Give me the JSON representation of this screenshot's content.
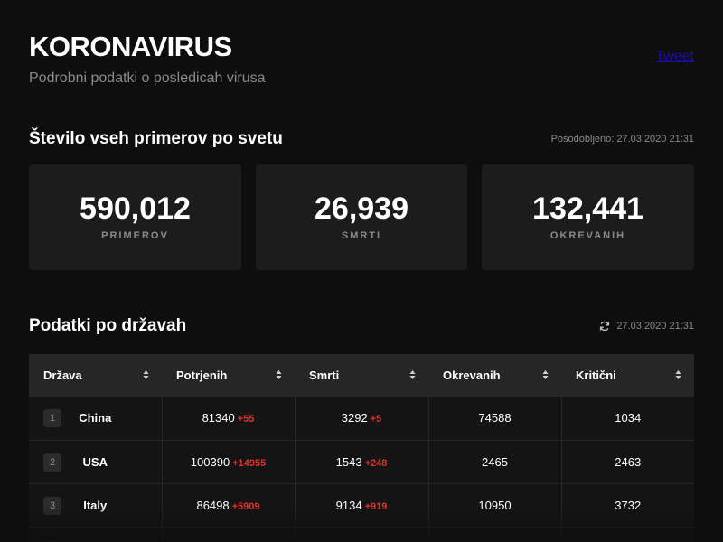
{
  "header": {
    "title": "KORONAVIRUS",
    "subtitle": "Podrobni podatki o posledicah virusa",
    "tweet_label": "Tweet"
  },
  "world": {
    "section_title": "Število vseh primerov po svetu",
    "updated": "Posodobljeno: 27.03.2020 21:31",
    "cards": [
      {
        "value": "590,012",
        "label": "PRIMEROV"
      },
      {
        "value": "26,939",
        "label": "SMRTI"
      },
      {
        "value": "132,441",
        "label": "OKREVANIH"
      }
    ]
  },
  "countries": {
    "section_title": "Podatki po državah",
    "updated": "27.03.2020 21:31",
    "refresh_icon": "refresh-icon",
    "columns": [
      "Država",
      "Potrjenih",
      "Smrti",
      "Okrevanih",
      "Kritični"
    ],
    "rows": [
      {
        "rank": "1",
        "country": "China",
        "confirmed": "81340",
        "confirmed_delta": "+55",
        "deaths": "3292",
        "deaths_delta": "+5",
        "recovered": "74588",
        "critical": "1034"
      },
      {
        "rank": "2",
        "country": "USA",
        "confirmed": "100390",
        "confirmed_delta": "+14955",
        "deaths": "1543",
        "deaths_delta": "+248",
        "recovered": "2465",
        "critical": "2463"
      },
      {
        "rank": "3",
        "country": "Italy",
        "confirmed": "86498",
        "confirmed_delta": "+5909",
        "deaths": "9134",
        "deaths_delta": "+919",
        "recovered": "10950",
        "critical": "3732"
      }
    ]
  },
  "colors": {
    "background": "#0e0e0e",
    "card": "#1c1c1c",
    "table_header": "#262626",
    "delta_red": "#e03131",
    "muted_text": "#8a8a8a"
  }
}
